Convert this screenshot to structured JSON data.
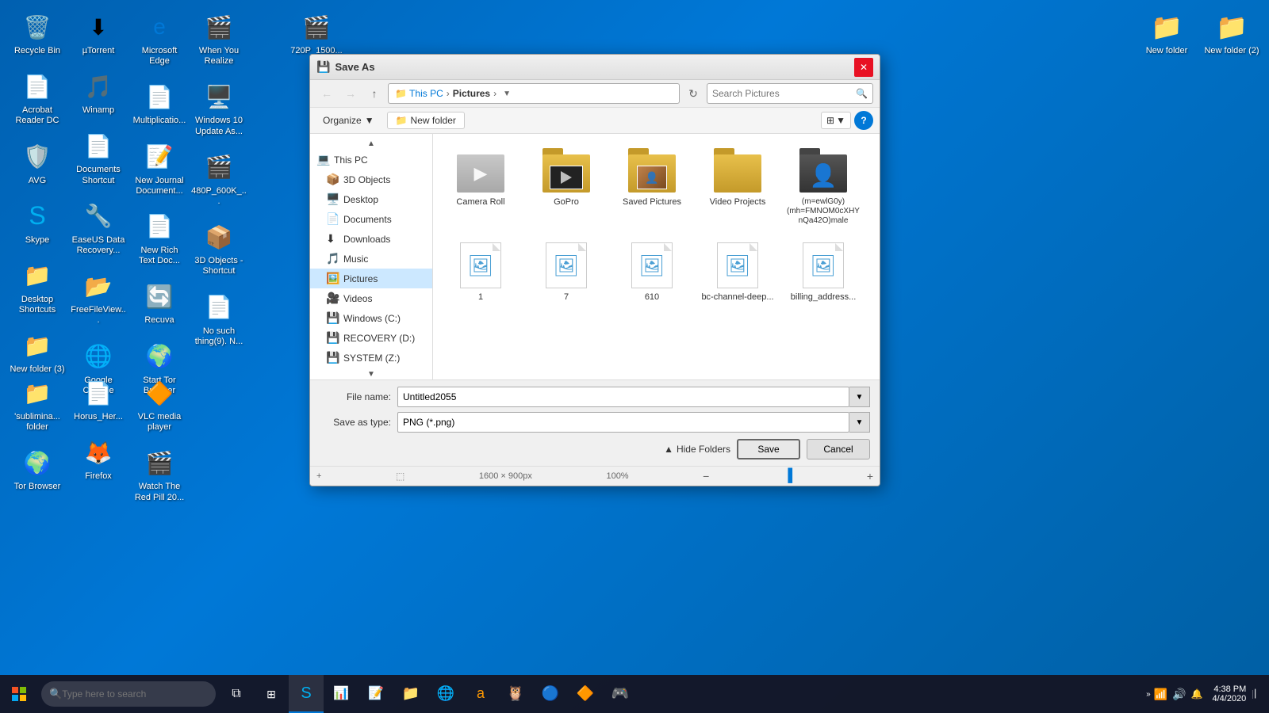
{
  "desktop": {
    "background": "#0078d7"
  },
  "desktop_icons_col1": [
    {
      "id": "recycle-bin",
      "label": "Recycle Bin",
      "icon": "🗑️"
    },
    {
      "id": "acrobat",
      "label": "Acrobat Reader DC",
      "icon": "📄"
    },
    {
      "id": "avg",
      "label": "AVG",
      "icon": "🛡️"
    },
    {
      "id": "skype",
      "label": "Skype",
      "icon": "💬"
    },
    {
      "id": "desktop-shortcuts",
      "label": "Desktop Shortcuts",
      "icon": "📁"
    },
    {
      "id": "new-folder-3",
      "label": "New folder (3)",
      "icon": "📁"
    }
  ],
  "desktop_icons_col2": [
    {
      "id": "utorrent",
      "label": "µTorrent",
      "icon": "⬇"
    },
    {
      "id": "winamp",
      "label": "Winamp",
      "icon": "🎵"
    },
    {
      "id": "documents-shortcut",
      "label": "Documents Shortcut",
      "icon": "📄"
    },
    {
      "id": "easeus",
      "label": "EaseUS Data Recovery...",
      "icon": "🔧"
    },
    {
      "id": "freefileview",
      "label": "FreeFileView...",
      "icon": "📂"
    },
    {
      "id": "google-chrome",
      "label": "Google Chrome",
      "icon": "🌐"
    }
  ],
  "desktop_icons_col3": [
    {
      "id": "ms-edge",
      "label": "Microsoft Edge",
      "icon": "🌐"
    },
    {
      "id": "multiplication",
      "label": "Multiplicatio...",
      "icon": "📄"
    },
    {
      "id": "new-journal",
      "label": "New Journal Document...",
      "icon": "📄"
    },
    {
      "id": "new-rich-text",
      "label": "New Rich Text Doc...",
      "icon": "📄"
    },
    {
      "id": "recuva",
      "label": "Recuva",
      "icon": "🔄"
    },
    {
      "id": "start-browser",
      "label": "Start Tor Browser",
      "icon": "🌍"
    }
  ],
  "desktop_icons_col4": [
    {
      "id": "when-you-realize",
      "label": "When You Realize",
      "icon": "🎬"
    },
    {
      "id": "windows-update",
      "label": "Windows 10 Update As...",
      "icon": "🖥️"
    },
    {
      "id": "480p",
      "label": "480P_600K_...",
      "icon": "🎬"
    },
    {
      "id": "3d-objects-sc",
      "label": "3D Objects - Shortcut",
      "icon": "📦"
    },
    {
      "id": "no-such-thing",
      "label": "No such thing(9). N...",
      "icon": "📄"
    }
  ],
  "desktop_icons_col5": [
    {
      "id": "720p",
      "label": "720P_1500...",
      "icon": "🎬"
    }
  ],
  "right_icons": [
    {
      "id": "new-folder-right",
      "label": "New folder",
      "icon": "📁"
    },
    {
      "id": "new-folder-2",
      "label": "New folder (2)",
      "icon": "📁"
    }
  ],
  "bottom_left_icons": [
    {
      "id": "subliminal-folder",
      "label": "'sublimina... folder",
      "icon": "📁"
    },
    {
      "id": "horus-her",
      "label": "Horus_Her...",
      "icon": "📄"
    },
    {
      "id": "vlc",
      "label": "VLC media player",
      "icon": "🔶"
    },
    {
      "id": "tor-browser",
      "label": "Tor Browser",
      "icon": "🌍"
    },
    {
      "id": "firefox",
      "label": "Firefox",
      "icon": "🦊"
    },
    {
      "id": "watch-red-pill",
      "label": "Watch The Red Pill 20...",
      "icon": "🎬"
    }
  ],
  "taskbar": {
    "search_placeholder": "Type here to search",
    "time": "4:38 PM",
    "date": "4/4/2020",
    "desktop_label": "Desktop"
  },
  "dialog": {
    "title": "Save As",
    "nav": {
      "back_disabled": true,
      "forward_disabled": true,
      "up_label": "Up",
      "refresh_label": "Refresh",
      "address": [
        "This PC",
        "Pictures"
      ],
      "search_placeholder": "Search Pictures"
    },
    "toolbar": {
      "organize_label": "Organize",
      "new_folder_label": "New folder"
    },
    "nav_panel": {
      "items": [
        {
          "id": "this-pc",
          "label": "This PC",
          "icon": "💻",
          "indent": 0
        },
        {
          "id": "3d-objects",
          "label": "3D Objects",
          "icon": "📦",
          "indent": 1
        },
        {
          "id": "desktop",
          "label": "Desktop",
          "icon": "🖥️",
          "indent": 1
        },
        {
          "id": "documents",
          "label": "Documents",
          "icon": "📄",
          "indent": 1
        },
        {
          "id": "downloads",
          "label": "Downloads",
          "icon": "⬇",
          "indent": 1
        },
        {
          "id": "music",
          "label": "Music",
          "icon": "🎵",
          "indent": 1
        },
        {
          "id": "pictures",
          "label": "Pictures",
          "icon": "🖼️",
          "indent": 1,
          "selected": true
        },
        {
          "id": "videos",
          "label": "Videos",
          "icon": "🎥",
          "indent": 1
        },
        {
          "id": "windows-c",
          "label": "Windows (C:)",
          "icon": "💾",
          "indent": 1
        },
        {
          "id": "recovery-d",
          "label": "RECOVERY (D:)",
          "icon": "💾",
          "indent": 1
        },
        {
          "id": "system-z",
          "label": "SYSTEM (Z:)",
          "icon": "💾",
          "indent": 1
        }
      ]
    },
    "files": [
      {
        "id": "camera-roll",
        "label": "Camera Roll",
        "type": "folder-camera"
      },
      {
        "id": "gopro",
        "label": "GoPro",
        "type": "folder-gopro"
      },
      {
        "id": "saved-pictures",
        "label": "Saved Pictures",
        "type": "folder-person"
      },
      {
        "id": "video-projects",
        "label": "Video Projects",
        "type": "folder-plain"
      },
      {
        "id": "dark-profile",
        "label": "(m=ewlG0y)(mh=FMNOM0cXHYnQa42O)male",
        "type": "folder-dark"
      },
      {
        "id": "img1",
        "label": "1",
        "type": "image"
      },
      {
        "id": "img2",
        "label": "7",
        "type": "image"
      },
      {
        "id": "img3",
        "label": "610",
        "type": "image"
      },
      {
        "id": "img4",
        "label": "bc-channel-deep...",
        "type": "image"
      },
      {
        "id": "img5",
        "label": "billing_address...",
        "type": "image"
      }
    ],
    "footer": {
      "filename_label": "File name:",
      "filename_value": "Untitled2055",
      "filetype_label": "Save as type:",
      "filetype_value": "PNG (*.png)",
      "hide_folders_label": "Hide Folders",
      "save_label": "Save",
      "cancel_label": "Cancel"
    },
    "statusbar": {
      "zoom_out": "−",
      "zoom_in": "+",
      "zoom_level": "100%",
      "dimensions": "1600 × 900px"
    }
  }
}
